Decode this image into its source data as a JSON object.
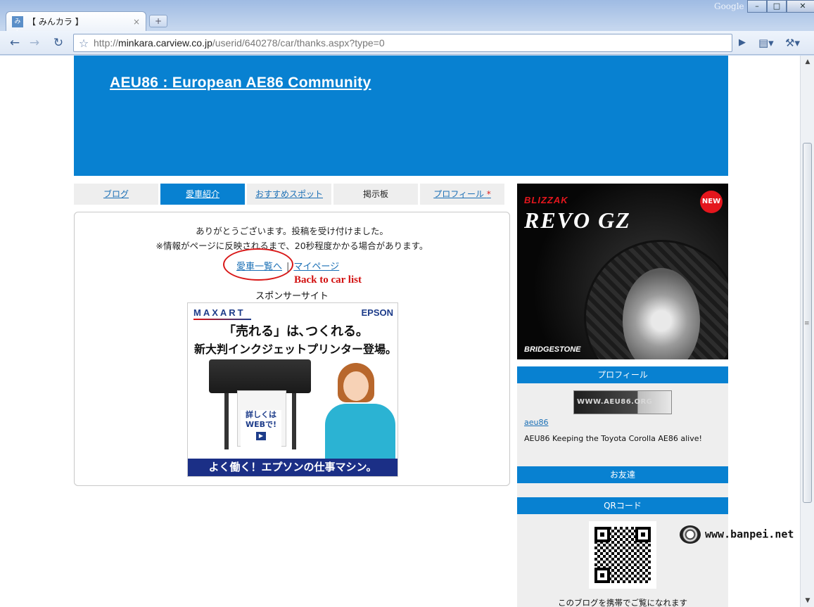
{
  "browser": {
    "tab_title": "【 みんカラ 】",
    "tab_favicon": "みん",
    "tab_close": "×",
    "new_tab": "+",
    "google": "Google",
    "url_prefix": "http://",
    "url_host": "minkara.carview.co.jp",
    "url_path": "/userid/640278/car/thanks.aspx?type=0"
  },
  "page": {
    "site_title": "AEU86 : European AE86 Community",
    "tabs": [
      {
        "label": "ブログ"
      },
      {
        "label": "愛車紹介"
      },
      {
        "label": "おすすめスポット"
      },
      {
        "label": "掲示板"
      },
      {
        "label": "プロフィール"
      }
    ],
    "profile_tab_marker": "*",
    "message_line1": "ありがとうございます。投稿を受け付けました。",
    "message_line2": "※情報がページに反映されるまで、20秒程度かかる場合があります。",
    "link_car_list": "愛車一覧へ",
    "link_separator": "|",
    "link_mypage": "マイページ",
    "annotation": "Back to car list",
    "sponsor_label": "スポンサーサイト"
  },
  "ad_epson": {
    "brand_left": "MAXART",
    "brand_right": "EPSON",
    "headline1": "「売れる」は､つくれる｡",
    "headline2": "新大判インクジェットプリンター登場｡",
    "web_button_line1": "詳しくは",
    "web_button_line2": "WEBで!",
    "play": "▶",
    "footer": "よく働く！エプソンの仕事マシン。"
  },
  "ad_tire": {
    "brand": "BLIZZAK",
    "product": "REVO GZ",
    "badge": "NEW",
    "maker": "BRIDGESTONE"
  },
  "sidebar": {
    "profile_heading": "プロフィール",
    "profile_image_text": "WWW.AEU86.ORG",
    "profile_name": "aeu86",
    "profile_desc": "AEU86 Keeping the Toyota Corolla AE86 alive!",
    "friends_heading": "お友達",
    "qr_heading": "QRコード",
    "qr_caption": "このブログを携帯でご覧になれます"
  },
  "watermark": "www.banpei.net"
}
